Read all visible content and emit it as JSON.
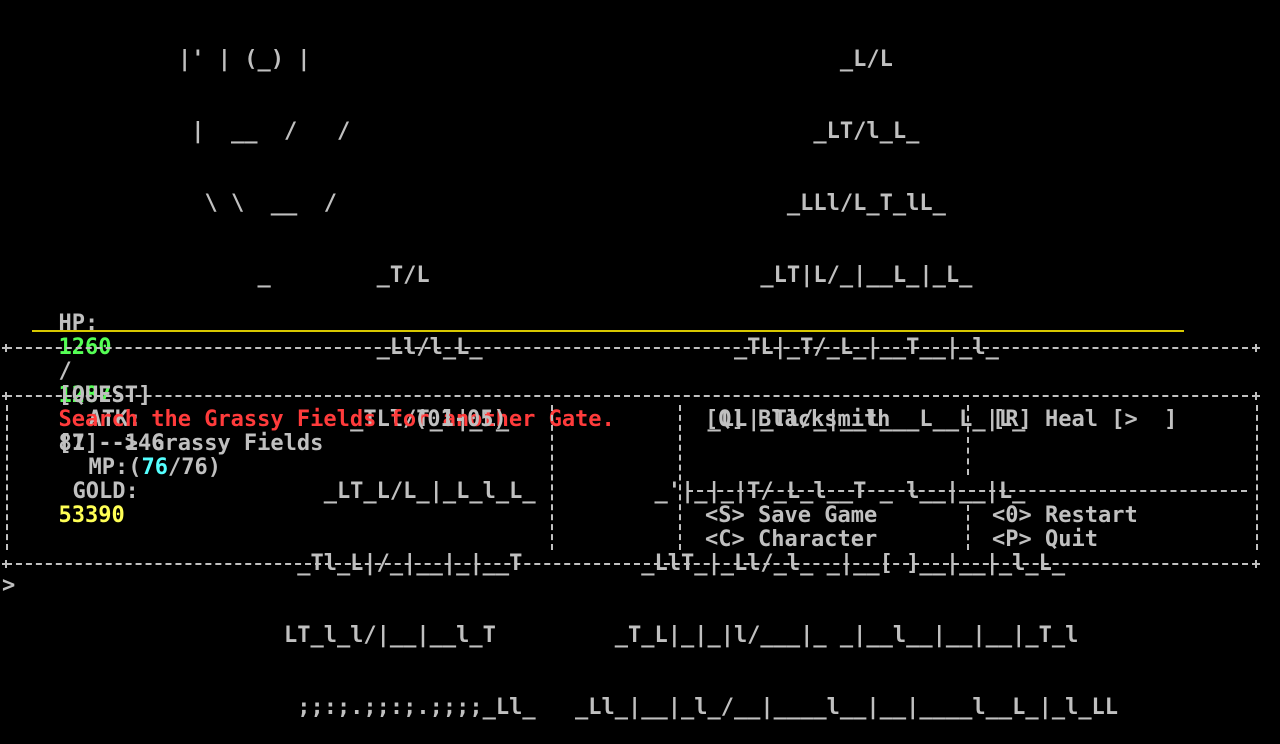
{
  "art_lines": [
    "|' | (_) |",
    " |  __  /   /",
    "  \\ \\  __  /",
    "      _        _T/L",
    "               _Ll/l_L_",
    "             _TLl/T_l|_L_",
    "           _LT_L/L_|_L_l_L_",
    "         _Tl_L|/_|__|_|__T",
    "        LT_l_l/|__|__l_T",
    "         ;;:;.;;:;.;;;;_Ll_"
  ],
  "mountain_lines": [
    "                    _L/L",
    "                  _LT/l_L_",
    "                _LLl/L_T_lL_",
    "              _LT|L/_|__L_|_L_",
    "            _TL|_T/_L_|__T__|_l_",
    "          _LL|_Tl/_|__l___L__L_|L_",
    "      _'|_|_|T/_L_l__T _ l__|__|L_",
    "     _LlT_|_Ll/_l_ _|__[ ]__|__|_l_L_",
    "   _T_L|_|_|l/___|_ _|__l__|__|__|_T_l",
    "_Ll_|__|_l_/__|____l__|__|____l__L_|_l_LL"
  ],
  "stats": {
    "hp_label": "HP:",
    "hp_current": "1260",
    "hp_sep": "/",
    "hp_max": "1287",
    "atk_label": "ATK:",
    "atk_value": "87 - 146",
    "mp_label": "MP:",
    "mp_open": "(",
    "mp_current": "76",
    "mp_rest": "/76)",
    "gold_label": "GOLD:",
    "gold_value": "53390"
  },
  "quest": {
    "tag": "[QUEST]",
    "text": "Search the Grassy Fields for another Gate."
  },
  "menu": {
    "destination": "[1] -> Grassy Fields",
    "level_range": "(01-05)",
    "blacksmith": "[Q] Blacksmith",
    "heal": "[R] Heal [>  ]",
    "save": "<S> Save Game",
    "character": "<C> Character",
    "restart": "<0> Restart",
    "quit": "<P> Quit"
  },
  "prompt": ">",
  "colors": {
    "hp": "#55ff55",
    "mp": "#55ffff",
    "gold": "#ffff55",
    "quest": "#ff3b3b"
  }
}
